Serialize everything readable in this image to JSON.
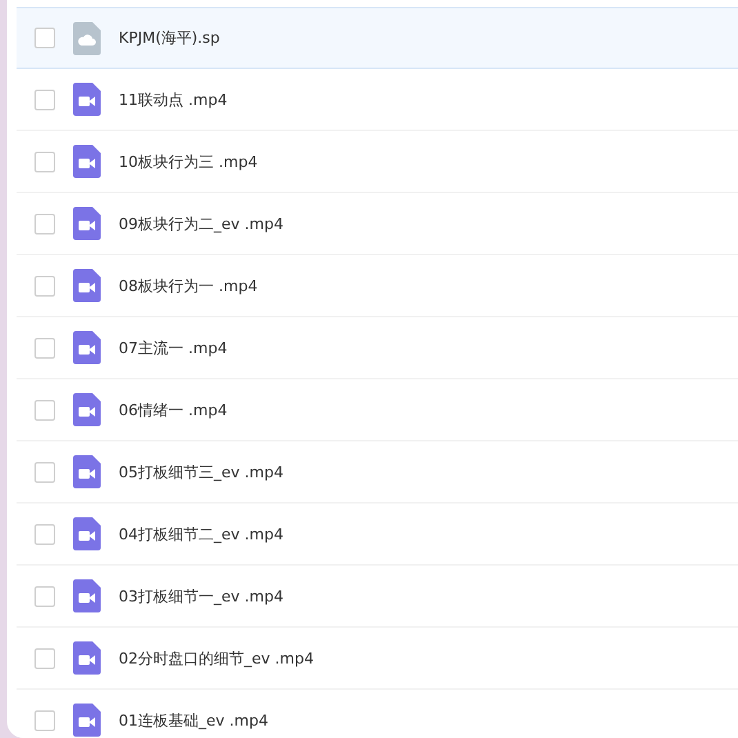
{
  "files": [
    {
      "name": "KPJM(海平).sp",
      "kind": "cloud",
      "highlighted": true,
      "checked": false
    },
    {
      "name": "11联动点 .mp4",
      "kind": "video",
      "highlighted": false,
      "checked": false
    },
    {
      "name": "10板块行为三 .mp4",
      "kind": "video",
      "highlighted": false,
      "checked": false
    },
    {
      "name": "09板块行为二_ev .mp4",
      "kind": "video",
      "highlighted": false,
      "checked": false
    },
    {
      "name": "08板块行为一 .mp4",
      "kind": "video",
      "highlighted": false,
      "checked": false
    },
    {
      "name": "07主流一 .mp4",
      "kind": "video",
      "highlighted": false,
      "checked": false
    },
    {
      "name": "06情绪一 .mp4",
      "kind": "video",
      "highlighted": false,
      "checked": false
    },
    {
      "name": "05打板细节三_ev .mp4",
      "kind": "video",
      "highlighted": false,
      "checked": false
    },
    {
      "name": "04打板细节二_ev .mp4",
      "kind": "video",
      "highlighted": false,
      "checked": false
    },
    {
      "name": "03打板细节一_ev .mp4",
      "kind": "video",
      "highlighted": false,
      "checked": false
    },
    {
      "name": "02分时盘口的细节_ev .mp4",
      "kind": "video",
      "highlighted": false,
      "checked": false
    },
    {
      "name": "01连板基础_ev .mp4",
      "kind": "video",
      "highlighted": false,
      "checked": false
    }
  ]
}
